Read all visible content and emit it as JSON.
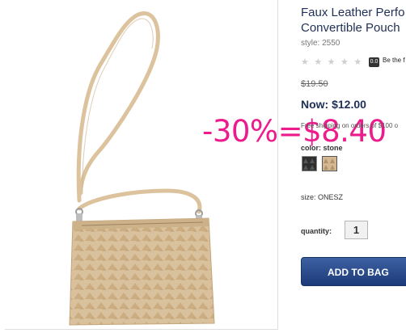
{
  "product": {
    "title_line1": "Faux Leather Perfo",
    "title_line2": "Convertible Pouch",
    "style": "style: 2550",
    "rating_badge": "0.0",
    "review_link": "Be the f",
    "old_price": "$19.50",
    "now_price": "Now: $12.00",
    "shipping": "Free shipping on orders of $100 o",
    "color_label": "color: stone",
    "swatches": [
      "black",
      "stone"
    ],
    "size": "size: ONESZ",
    "quantity_label": "quantity:",
    "quantity_value": "1",
    "add_to_bag": "ADD TO BAG"
  },
  "overlay": {
    "discount_text": "-30%=$8.40",
    "color": "#ec1c8c"
  },
  "colors": {
    "title": "#1f2f55",
    "button": "#2a4a8c",
    "bag": "#d9c19e"
  }
}
